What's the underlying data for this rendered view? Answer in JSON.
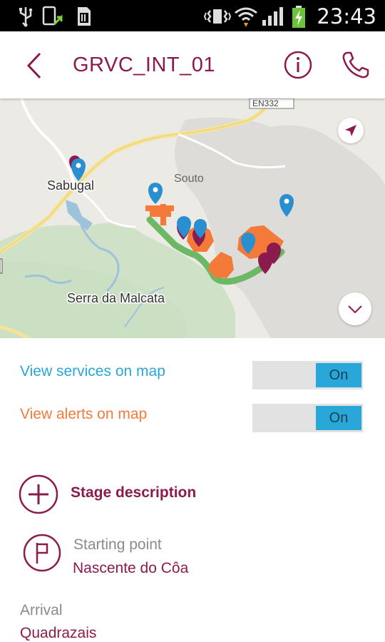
{
  "status_bar": {
    "time": "23:43"
  },
  "app_bar": {
    "title": "GRVC_INT_01"
  },
  "map": {
    "labels": {
      "road_shield": "EN332",
      "town": "Sabugal",
      "village": "Souto",
      "range": "Serra da Malcata"
    }
  },
  "toggles": [
    {
      "label": "View services on map",
      "state": "On",
      "color": "#2aa7d9"
    },
    {
      "label": "View alerts on map",
      "state": "On",
      "color": "#f47a3a"
    }
  ],
  "stage": {
    "label": "Stage description"
  },
  "starting_point": {
    "label": "Starting point",
    "value": "Nascente do Côa"
  },
  "arrival": {
    "label": "Arrival",
    "value": "Quadrazais"
  },
  "colors": {
    "brand": "#8b1a4f",
    "services": "#2aa7d9",
    "alerts": "#f47a3a"
  }
}
